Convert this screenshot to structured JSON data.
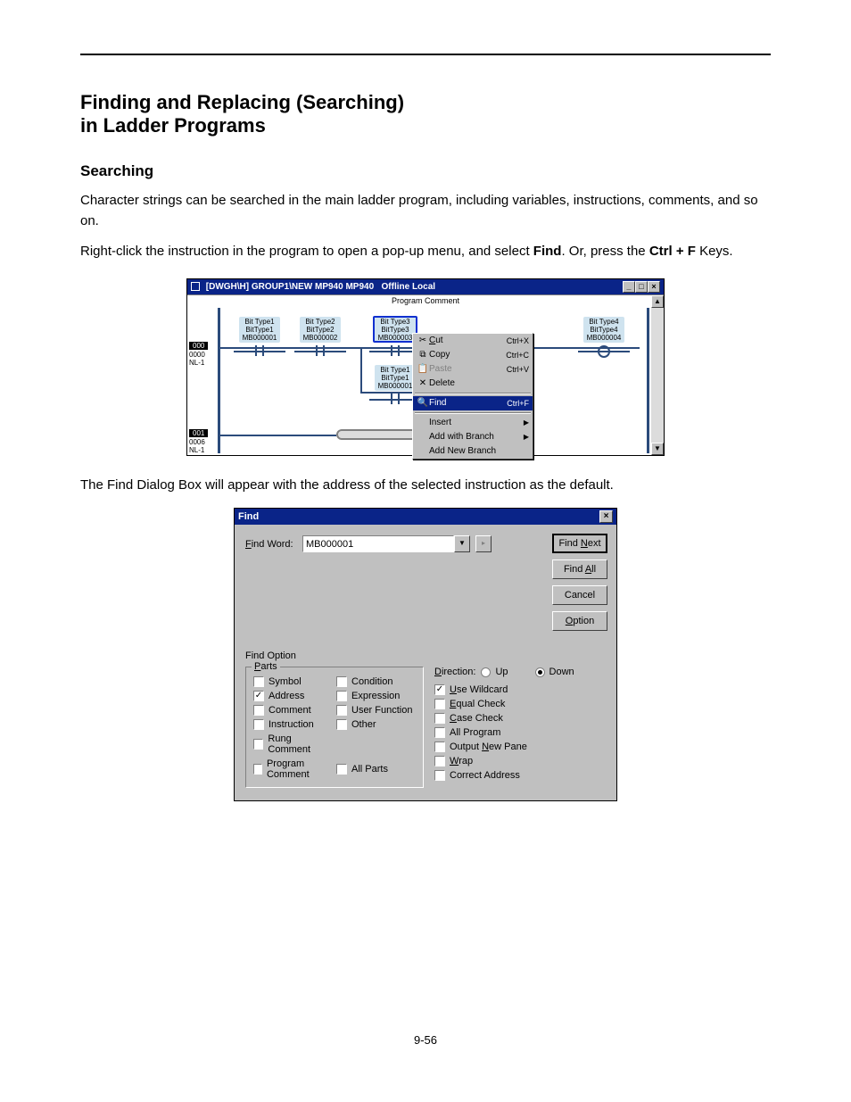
{
  "doc": {
    "heading_line1": "Finding and Replacing (Searching)",
    "heading_line2": "in Ladder Programs",
    "heading_sub": "Searching",
    "p1a": "Character strings can be searched in the main ladder program, including variables, instructions, comments, and so on.",
    "p1b_prefix": "Right-click the instruction in the program to open a pop-up menu, and select ",
    "p1b_find": "Find",
    "p1b_suffix": ". Or, press the ",
    "p1b_keys": "Ctrl + F",
    "p1b_tail": " Keys.",
    "after_fig1": "The Find Dialog Box will appear with the address of the selected instruction as the default.",
    "footer": "9-56"
  },
  "fig1": {
    "title_main": "[DWGH\\H]   GROUP1\\NEW  MP940  MP940",
    "title_right": "Offline  Local",
    "program_comment": "Program Comment",
    "rung0": {
      "badge": "000",
      "addr": "0000",
      "nl": "NL-1"
    },
    "rung1": {
      "badge": "001",
      "addr": "0006",
      "nl": "NL-1"
    },
    "c1": {
      "l1": "Bit Type1",
      "l2": "BitType1",
      "l3": "MB000001"
    },
    "c2": {
      "l1": "Bit Type2",
      "l2": "BitType2",
      "l3": "MB000002"
    },
    "c3": {
      "l1": "Bit Type3",
      "l2": "BitType3",
      "l3": "MB000003"
    },
    "c4": {
      "l1": "Bit Type4",
      "l2": "BitType4",
      "l3": "MB000004"
    },
    "c5": {
      "l1": "Bit Type1",
      "l2": "BitType1",
      "l3": "MB000001"
    },
    "menu": {
      "cut": "Cut",
      "cut_k": "Ctrl+X",
      "copy": "Copy",
      "copy_k": "Ctrl+C",
      "paste": "Paste",
      "paste_k": "Ctrl+V",
      "delete": "Delete",
      "find": "Find",
      "find_k": "Ctrl+F",
      "insert": "Insert",
      "addwb": "Add with Branch",
      "addnb": "Add New Branch"
    }
  },
  "fig2": {
    "title": "Find",
    "find_word_label": "Find Word:",
    "find_word_value": "MB000001",
    "btn_findnext": "Find Next",
    "btn_findall": "Find All",
    "btn_cancel": "Cancel",
    "btn_option": "Option",
    "find_option": "Find Option",
    "parts_title": "Parts",
    "parts": {
      "symbol": "Symbol",
      "address": "Address",
      "comment": "Comment",
      "instruction": "Instruction",
      "rungcomment": "Rung Comment",
      "programcomment": "Program Comment",
      "condition": "Condition",
      "expression": "Expression",
      "userfunc": "User Function",
      "other": "Other",
      "allparts": "All Parts"
    },
    "direction": "Direction:",
    "up": "Up",
    "down": "Down",
    "mid": {
      "wildcard": "Use Wildcard",
      "equal": "Equal Check",
      "case": "Case Check",
      "allprog": "All Program",
      "newpane": "Output New Pane",
      "wrap": "Wrap",
      "correct": "Correct Address"
    }
  }
}
